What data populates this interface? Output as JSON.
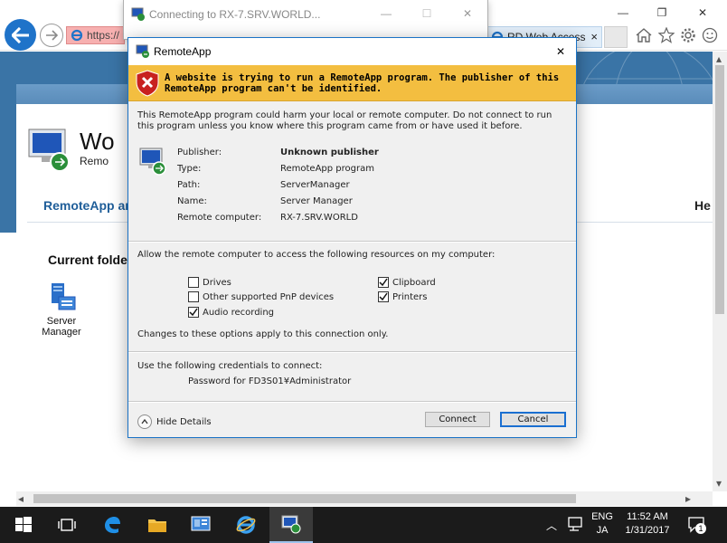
{
  "browser": {
    "url_fragment": "https://",
    "background_tab_title": "RD Web Access",
    "tab_close_glyph": "×",
    "window_controls": [
      "—",
      "❐",
      "✕"
    ],
    "toolbar_icons": [
      "home-icon",
      "favorites-star-icon",
      "settings-gear-icon",
      "smiley-feedback-icon"
    ]
  },
  "connecting_window": {
    "title": "Connecting to RX-7.SRV.WORLD...",
    "controls": [
      "—",
      "☐",
      "✕"
    ]
  },
  "page": {
    "title_partial": "Wo",
    "subtitle_partial": "Remo",
    "nav_tab_partial": "RemoteApp ar",
    "help_partial": "He",
    "current_folder_partial": "Current folde",
    "app_tile": {
      "label_line1": "Server",
      "label_line2": "Manager"
    }
  },
  "dialog": {
    "title": "RemoteApp",
    "close_glyph": "✕",
    "warning": "A website is trying to run a RemoteApp program. The publisher of this RemoteApp program can't be identified.",
    "intro": "This RemoteApp program could harm your local or remote computer. Do not connect to run this program unless you know where this program came from or have used it before.",
    "details": [
      {
        "label": "Publisher:",
        "value": "Unknown publisher",
        "bold": true
      },
      {
        "label": "Type:",
        "value": "RemoteApp program"
      },
      {
        "label": "Path:",
        "value": "ServerManager"
      },
      {
        "label": "Name:",
        "value": "Server Manager"
      },
      {
        "label": "Remote computer:",
        "value": "RX-7.SRV.WORLD"
      }
    ],
    "allow_text": "Allow the remote computer to access the following resources on my computer:",
    "resources": [
      {
        "label": "Drives",
        "checked": false
      },
      {
        "label": "Clipboard",
        "checked": true
      },
      {
        "label": "Other supported PnP devices",
        "checked": false
      },
      {
        "label": "Printers",
        "checked": true
      },
      {
        "label": "Audio recording",
        "checked": true
      }
    ],
    "changes_note": "Changes to these options apply to this connection only.",
    "creds_text": "Use the following credentials to connect:",
    "creds_user": "Password for FD3S01¥Administrator",
    "hide_details": "Hide Details",
    "connect_label": "Connect",
    "cancel_label": "Cancel"
  },
  "taskbar": {
    "lang_line1": "ENG",
    "lang_line2": "JA",
    "time": "11:52 AM",
    "date": "1/31/2017",
    "notification_count": "1"
  }
}
